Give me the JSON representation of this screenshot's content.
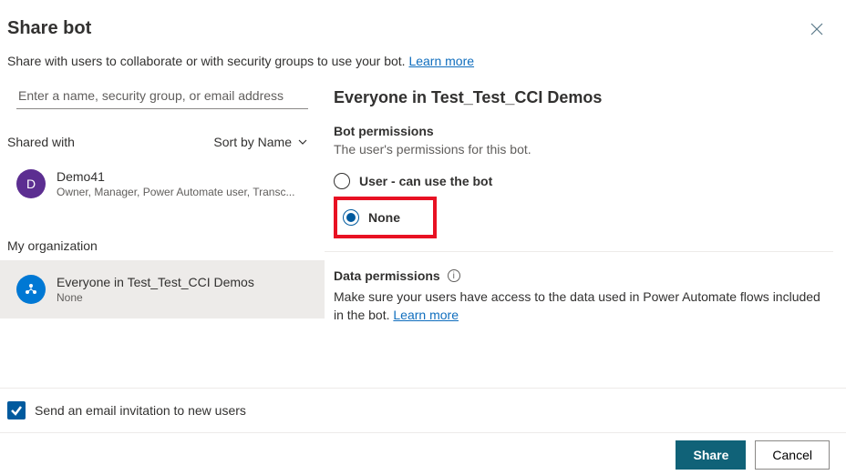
{
  "title": "Share bot",
  "description": "Share with users to collaborate or with security groups to use your bot.",
  "learn_more": "Learn more",
  "search": {
    "placeholder": "Enter a name, security group, or email address"
  },
  "shared_with_label": "Shared with",
  "sort_label": "Sort by Name",
  "user": {
    "initial": "D",
    "name": "Demo41",
    "roles": "Owner, Manager, Power Automate user, Transc..."
  },
  "org_label": "My organization",
  "org_entry": {
    "name": "Everyone in Test_Test_CCI Demos",
    "perm": "None"
  },
  "right": {
    "entity": "Everyone in Test_Test_CCI Demos",
    "bot_perm_head": "Bot permissions",
    "bot_perm_sub": "The user's permissions for this bot.",
    "radio_user": "User - can use the bot",
    "radio_none": "None",
    "data_perm_head": "Data permissions",
    "data_perm_body": "Make sure your users have access to the data used in Power Automate flows included in the bot.",
    "data_learn_more": "Learn more"
  },
  "footer_checkbox": "Send an email invitation to new users",
  "buttons": {
    "share": "Share",
    "cancel": "Cancel"
  }
}
